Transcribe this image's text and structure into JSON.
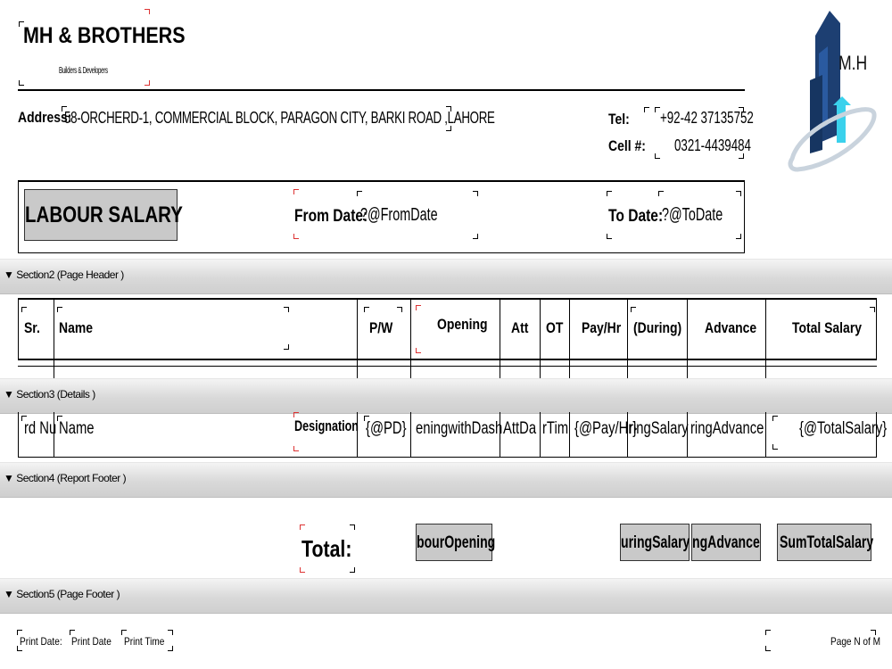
{
  "company": {
    "name": "MH & BROTHERS",
    "tagline": "Builders & Developers"
  },
  "logo": {
    "text": "M.H"
  },
  "address": {
    "label": "Address:",
    "value": "58-ORCHERD-1, COMMERCIAL BLOCK, PARAGON CITY, BARKI ROAD ,LAHORE"
  },
  "contact": {
    "tel_label": "Tel:",
    "tel_value": "+92-42 37135752",
    "cell_label": "Cell #:",
    "cell_value": "0321-4439484"
  },
  "title_block": {
    "report_title": "LABOUR SALARY",
    "from_label": "From Date:",
    "from_value": "?@FromDate",
    "to_label": "To Date:",
    "to_value": "?@ToDate"
  },
  "sections": {
    "page_header": "▼ Section2 (Page Header )",
    "details": "▼ Section3 (Details )",
    "report_footer": "▼ Section4 (Report Footer )",
    "page_footer": "▼ Section5 (Page Footer )"
  },
  "columns": [
    "Sr.",
    "Name",
    "P/W",
    "Opening",
    "Att",
    "OT",
    "Pay/Hr",
    "(During)",
    "Advance",
    "Total Salary"
  ],
  "detail_fields": {
    "sr": "rd Nu",
    "name": "Name",
    "designation": "Designation",
    "pw": "{@PD}",
    "opening": "eningwithDash",
    "att": "AttDa",
    "ot": "rTim",
    "pay_hr": "{@Pay/Hr}",
    "during": "ringSalary",
    "advance": "ringAdvance",
    "total": "{@TotalSalary}"
  },
  "footer_totals": {
    "label": "Total:",
    "opening": "bourOpening",
    "during": "uringSalary",
    "advance": "ngAdvance",
    "total": "SumTotalSalary"
  },
  "page_footer": {
    "print_date_label": "Print Date:",
    "print_date_value": "Print Date",
    "print_time_value": "Print Time",
    "page_n_of_m": "Page N of M"
  }
}
